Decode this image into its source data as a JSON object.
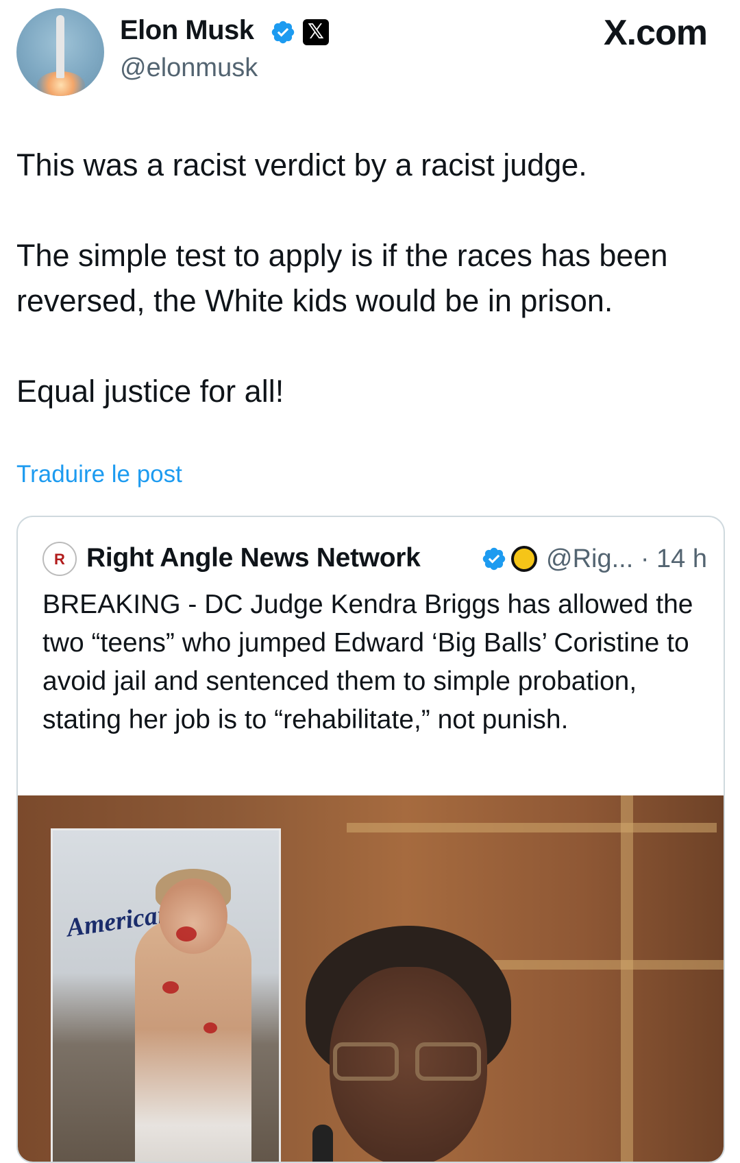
{
  "header": {
    "author_name": "Elon Musk",
    "handle": "@elonmusk",
    "site_logo": "X.com",
    "x_badge": "𝕏",
    "icons": [
      "rocket-avatar",
      "verified-badge-icon",
      "x-affiliate-icon"
    ]
  },
  "tweet": {
    "paragraphs": [
      "This was a racist verdict by a racist judge.",
      "The simple test to apply is if the races has been reversed, the White kids would be in prison.",
      "Equal justice for all!"
    ],
    "translate_link": "Traduire le post"
  },
  "quote": {
    "logo_text": "R",
    "account_name": "Right Angle News Network",
    "handle_time": "@Rig... · 14 h",
    "text": "BREAKING - DC Judge Kendra Briggs has allowed the two “teens” who jumped Edward ‘Big Balls’ Coristine to avoid jail and sentenced them to simple probation, stating her job is to “rehabilitate,” not punish.",
    "media": {
      "inset_van_text": "American"
    }
  },
  "colors": {
    "link": "#1d9bf0",
    "verified": "#1d9bf0",
    "text": "#0f1419",
    "secondary": "#536471"
  }
}
